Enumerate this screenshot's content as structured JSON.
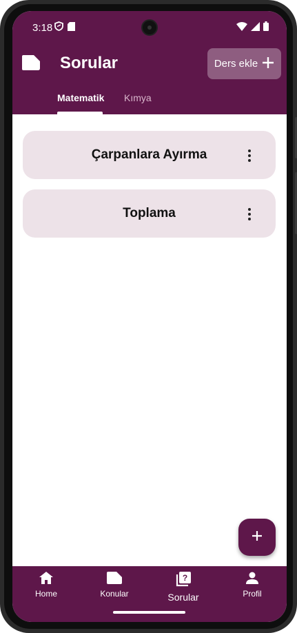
{
  "status_bar": {
    "time": "3:18",
    "left_icons": [
      "shield-icon",
      "sd-card-icon"
    ],
    "right_icons": [
      "wifi-icon",
      "signal-icon",
      "battery-icon"
    ]
  },
  "app_bar": {
    "title": "Sorular",
    "logo_icon": "label-icon",
    "add_course_label": "Ders ekle",
    "add_course_icon": "plus-icon",
    "background_color": "#5e174a"
  },
  "tabs": [
    {
      "label": "Matematik",
      "selected": true
    },
    {
      "label": "Kımya",
      "selected": false
    }
  ],
  "topics": [
    {
      "title": "Çarpanlara Ayırma",
      "menu_icon": "more-vert-icon"
    },
    {
      "title": "Toplama",
      "menu_icon": "more-vert-icon"
    }
  ],
  "fab": {
    "icon": "plus-icon"
  },
  "bottom_nav": [
    {
      "label": "Home",
      "icon": "home-icon",
      "active": false
    },
    {
      "label": "Konular",
      "icon": "label-icon",
      "active": false
    },
    {
      "label": "Sorular",
      "icon": "quiz-icon",
      "active": true
    },
    {
      "label": "Profil",
      "icon": "person-icon",
      "active": false
    }
  ],
  "colors": {
    "primary": "#5e174a",
    "card_background": "#ede2e8",
    "inactive_tab": "#d9b6cc"
  }
}
